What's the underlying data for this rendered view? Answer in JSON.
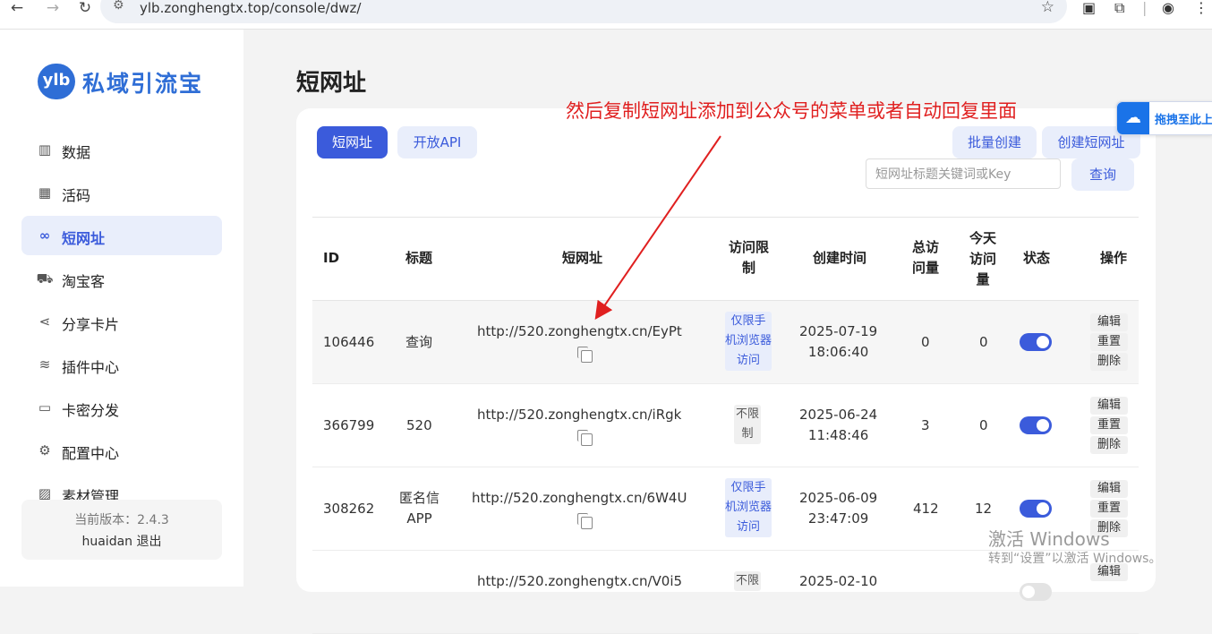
{
  "browser": {
    "url": "ylb.zonghengtx.top/console/dwz/"
  },
  "sidebar": {
    "logo_badge": "ylb",
    "logo_text": "私域引流宝",
    "items": [
      {
        "label": "数据",
        "icon": "chart-icon"
      },
      {
        "label": "活码",
        "icon": "grid-icon"
      },
      {
        "label": "短网址",
        "icon": "link-icon",
        "active": true
      },
      {
        "label": "淘宝客",
        "icon": "cart-icon"
      },
      {
        "label": "分享卡片",
        "icon": "share-icon"
      },
      {
        "label": "插件中心",
        "icon": "layers-icon"
      },
      {
        "label": "卡密分发",
        "icon": "card-icon"
      },
      {
        "label": "配置中心",
        "icon": "settings-icon"
      },
      {
        "label": "素材管理",
        "icon": "image-icon"
      }
    ],
    "version": "当前版本：2.4.3",
    "user": "huaidan",
    "logout": "退出"
  },
  "page": {
    "title": "短网址",
    "tab_active": "短网址",
    "tab_other": "开放API",
    "batch_create": "批量创建",
    "create": "创建短网址",
    "search_placeholder": "短网址标题关键词或Key",
    "search_button": "查询"
  },
  "table": {
    "headers": {
      "id": "ID",
      "title": "标题",
      "url": "短网址",
      "limit_1": "访问限",
      "limit_2": "制",
      "created": "创建时间",
      "total_1": "总访",
      "total_2": "问量",
      "today_1": "今天",
      "today_2": "访问",
      "today_3": "量",
      "status": "状态",
      "ops": "操作"
    },
    "rows": [
      {
        "id": "106446",
        "title_1": "查询",
        "title_2": "",
        "url": "http://520.zonghengtx.cn/EyPt",
        "limit_1": "仅限手",
        "limit_2": "机浏览器",
        "limit_3": "访问",
        "date": "2025-07-19",
        "time": "18:06:40",
        "total": "0",
        "today": "0",
        "enabled": true
      },
      {
        "id": "366799",
        "title_1": "520",
        "title_2": "",
        "url": "http://520.zonghengtx.cn/iRgk",
        "limit_1": "不限",
        "limit_2": "制",
        "limit_3": "",
        "date": "2025-06-24",
        "time": "11:48:46",
        "total": "3",
        "today": "0",
        "enabled": true
      },
      {
        "id": "308262",
        "title_1": "匿名信",
        "title_2": "APP",
        "url": "http://520.zonghengtx.cn/6W4U",
        "limit_1": "仅限手",
        "limit_2": "机浏览器",
        "limit_3": "访问",
        "date": "2025-06-09",
        "time": "23:47:09",
        "total": "412",
        "today": "12",
        "enabled": true
      },
      {
        "id": "",
        "title_1": "",
        "title_2": "",
        "url": "http://520.zonghengtx.cn/V0i5",
        "limit_1": "不限",
        "limit_2": "",
        "limit_3": "",
        "date": "2025-02-10",
        "time": "",
        "total": "",
        "today": "",
        "enabled": false
      }
    ],
    "ops": {
      "edit": "编辑",
      "reset": "重置",
      "delete": "删除"
    }
  },
  "overlay": {
    "annotation": "然后复制短网址添加到公众号的菜单或者自动回复里面",
    "widget_label": "拖拽至此上",
    "watermark_title": "激活 Windows",
    "watermark_sub": "转到“设置”以激活 Windows。"
  },
  "colors": {
    "accent": "#3b5bdb",
    "accent_light": "#e9eefb",
    "annotation": "#e02020"
  }
}
